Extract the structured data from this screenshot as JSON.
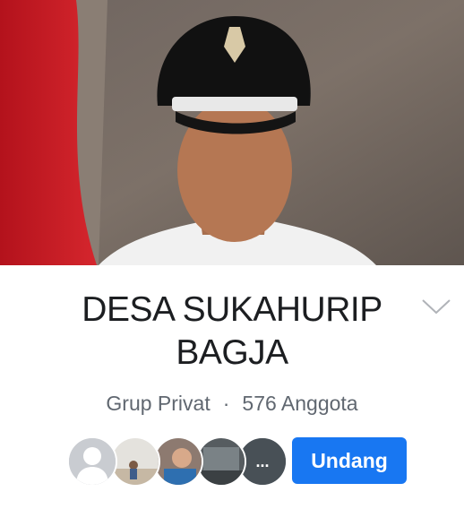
{
  "group": {
    "name_line1": "DESA SUKAHURIP",
    "name_line2": "BAGJA",
    "privacy": "Grup Privat",
    "separator": "·",
    "members": "576 Anggota"
  },
  "actions": {
    "invite_label": "Undang",
    "more_members_label": "..."
  },
  "colors": {
    "primary": "#1877f2",
    "text": "#1c1e21",
    "secondary_text": "#606770"
  },
  "icons": {
    "expand": "chevron-down-icon",
    "default_avatar": "person-silhouette-icon"
  }
}
